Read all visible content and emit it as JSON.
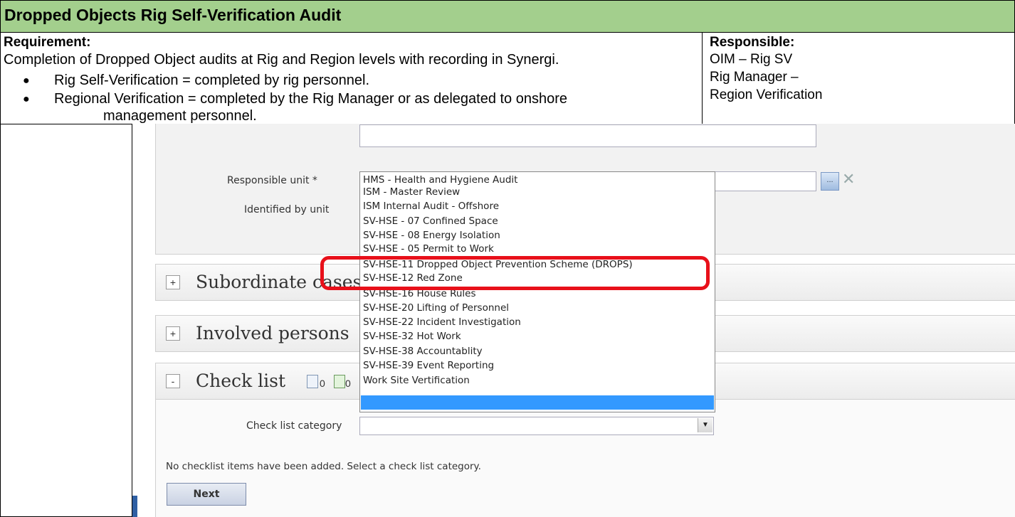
{
  "document": {
    "title": "Dropped Objects Rig Self-Verification Audit",
    "requirement_label": "Requirement:",
    "requirement_text": "Completion of Dropped Object audits at Rig and Region levels with recording in Synergi.",
    "bullets": [
      "Rig Self-Verification = completed by rig personnel.",
      "Regional Verification = completed by the Rig Manager or as delegated to onshore",
      "management personnel."
    ],
    "responsible_label": "Responsible:",
    "responsible_lines": [
      "OIM – Rig SV",
      "Rig Manager –",
      "Region Verification"
    ]
  },
  "form": {
    "responsible_unit_label": "Responsible unit *",
    "identified_by_label": "Identified by unit",
    "subordinate_cases": "Subordinate cases",
    "involved_persons": "Involved persons",
    "check_list": "Check list",
    "count_a": "0",
    "count_b": "0",
    "check_list_category_label": "Check list category",
    "no_items_message": "No checklist items have been added. Select a check list category.",
    "next_button": "Next"
  },
  "dropdown_options": [
    "HMS - Health and Hygiene Audit",
    "ISM - Master Review",
    "ISM Internal Audit - Offshore",
    "SV-HSE - 07 Confined Space",
    "SV-HSE - 08 Energy Isolation",
    "SV-HSE - 05 Permit to Work",
    "SV-HSE-11 Dropped Object Prevention Scheme (DROPS)",
    "SV-HSE-12 Red Zone",
    "SV-HSE-16 House Rules",
    "SV-HSE-20 Lifting of Personnel",
    "SV-HSE-22 Incident Investigation",
    "SV-HSE-32 Hot Work",
    "SV-HSE-38 Accountablity",
    "SV-HSE-39 Event Reporting",
    "Work Site Vertification"
  ],
  "colors": {
    "title_bg": "#a3cf8d",
    "highlight": "#e8101a",
    "selection": "#3399ff"
  }
}
